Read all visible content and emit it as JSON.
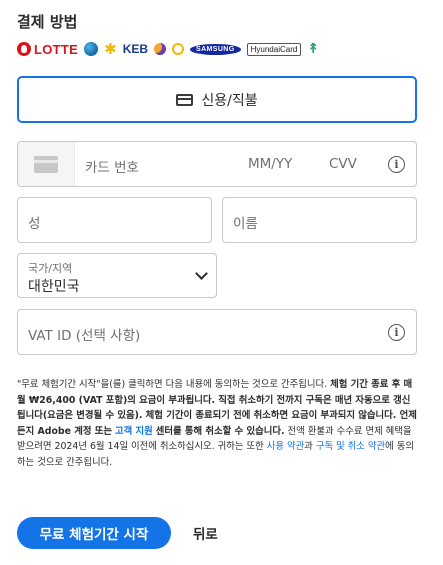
{
  "section_title": "결제 방법",
  "accepted_cards": {
    "lotte": "LOTTE",
    "keb": "KEB",
    "samsung": "SAMSUNG",
    "hyundai": "HyundaiCard",
    "icons": [
      "lotte-logo",
      "globe-logo",
      "kb-star-logo",
      "keb-logo",
      "moon-logo",
      "medal-logo",
      "samsung-logo",
      "hyundai-logo",
      "nh-logo"
    ]
  },
  "payment_tab": {
    "label": "신용/직불",
    "icon": "credit-card-icon"
  },
  "card_field": {
    "number_placeholder": "카드 번호",
    "expiry_placeholder": "MM/YY",
    "cvv_placeholder": "CVV",
    "info_glyph": "i"
  },
  "name_fields": {
    "last_placeholder": "성",
    "first_placeholder": "이름"
  },
  "country_select": {
    "label": "국가/지역",
    "value": "대한민국"
  },
  "vat_field": {
    "placeholder": "VAT ID (선택 사항)",
    "info_glyph": "i"
  },
  "legal": {
    "intro": "\"무료 체험기간 시작\"을(를) 클릭하면 다음 내용에 동의하는 것으로 간주됩니다.",
    "bold_text": "체험 기간 종료 후 매월 ₩26,400 (VAT 포함)의 요금이 부과됩니다. 직접 취소하기 전까지 구독은 매년 자동으로 갱신됩니다(요금은 변경될 수 있음). 체험 기간이 종료되기 전에 취소하면 요금이 부과되지 않습니다. 언제든지 Adobe 계정 또는",
    "link_support": "고객 지원",
    "bold_after_link": "센터를 통해 취소할 수 있습니다.",
    "plain_text": "전액 환불과 수수료 면제 혜택을 받으려면 2024년 6월 14일 이전에 취소하십시오. 귀하는 또한",
    "link_terms": "사용 약관",
    "and_text": "과",
    "link_cancel_terms": "구독 및 취소 약관",
    "end_text": "에 동의하는 것으로 간주됩니다."
  },
  "buttons": {
    "start_trial": "무료 체험기간 시작",
    "back": "뒤로"
  }
}
